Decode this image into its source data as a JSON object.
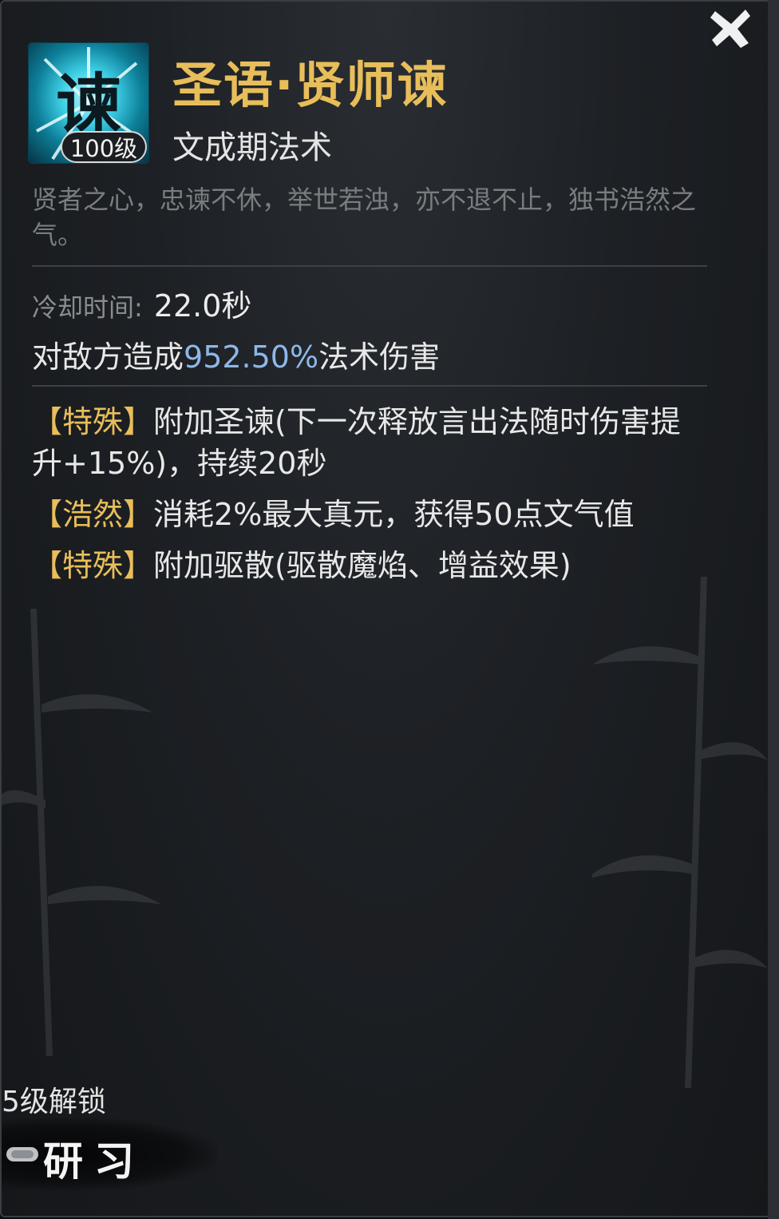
{
  "skill": {
    "name": "圣语·贤师谏",
    "level_badge": "100级",
    "category": "文成期法术",
    "description": "贤者之心，忠谏不休，举世若浊，亦不退不止，独书浩然之气。"
  },
  "stats": {
    "cooldown_label": "冷却时间:",
    "cooldown_value": "22.0秒",
    "damage_prefix": "对敌方造成",
    "damage_value": "952.50%",
    "damage_suffix": "法术伤害"
  },
  "effects": [
    {
      "tag": "【特殊】",
      "text": "附加圣谏(下一次释放言出法随时伤害提升+15%)，持续20秒"
    },
    {
      "tag": "【浩然】",
      "text": "消耗2%最大真元，获得50点文气值"
    },
    {
      "tag": "【特殊】",
      "text": "附加驱散(驱散魔焰、增益效果)"
    }
  ],
  "footer": {
    "unlock_text": "5级解锁",
    "study_label": "研习"
  },
  "icons": {
    "close": "close-icon",
    "skill": "skill-icon",
    "study": "study-icon"
  },
  "colors": {
    "title": "#e8be5a",
    "tag": "#e8be5a",
    "damage_value": "#8db8e8",
    "description": "#7a7d80"
  }
}
